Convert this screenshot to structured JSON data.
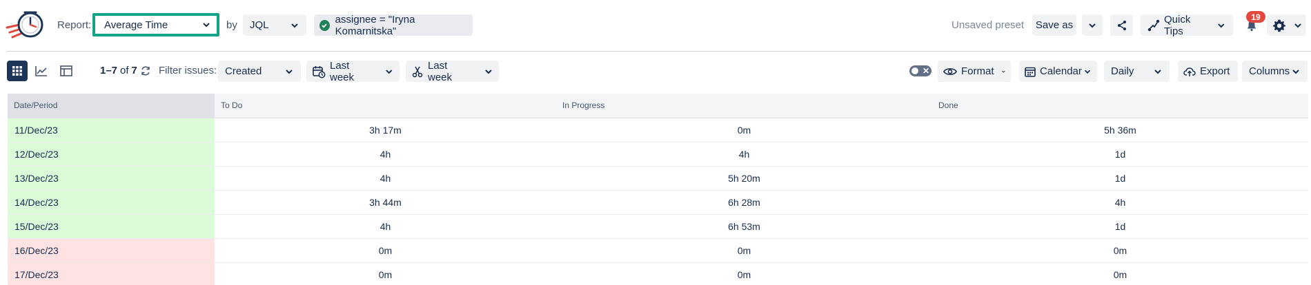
{
  "header": {
    "report_label": "Report:",
    "report_value": "Average Time",
    "by_label": "by",
    "by_value": "JQL",
    "jql_query": "assignee = \"Iryna Komarnitska\"",
    "unsaved_preset": "Unsaved preset",
    "save_as": "Save as",
    "quick_tips": "Quick Tips",
    "notification_count": "19"
  },
  "toolbar": {
    "range_start_end": "1–7",
    "range_of": "of",
    "range_total": "7",
    "filter_label": "Filter issues:",
    "filter_value": "Created",
    "date_filter_1": "Last week",
    "date_filter_2": "Last week",
    "format": "Format",
    "calendar": "Calendar",
    "granularity": "Daily",
    "export": "Export",
    "columns": "Columns"
  },
  "colors": {
    "accent_highlight": "#13a388",
    "weekday_row": "#dcfbd9",
    "weekend_row": "#ffe2e2",
    "badge": "#e2483d"
  },
  "table": {
    "headers": [
      "Date/Period",
      "To Do",
      "In Progress",
      "Done"
    ],
    "rows": [
      {
        "date": "11/Dec/23",
        "todo": "3h 17m",
        "inprogress": "0m",
        "done": "5h 36m",
        "status": "weekday"
      },
      {
        "date": "12/Dec/23",
        "todo": "4h",
        "inprogress": "4h",
        "done": "1d",
        "status": "weekday"
      },
      {
        "date": "13/Dec/23",
        "todo": "4h",
        "inprogress": "5h 20m",
        "done": "1d",
        "status": "weekday"
      },
      {
        "date": "14/Dec/23",
        "todo": "3h 44m",
        "inprogress": "6h 28m",
        "done": "4h",
        "status": "weekday"
      },
      {
        "date": "15/Dec/23",
        "todo": "4h",
        "inprogress": "6h 53m",
        "done": "1d",
        "status": "weekday"
      },
      {
        "date": "16/Dec/23",
        "todo": "0m",
        "inprogress": "0m",
        "done": "0m",
        "status": "weekend"
      },
      {
        "date": "17/Dec/23",
        "todo": "0m",
        "inprogress": "0m",
        "done": "0m",
        "status": "weekend"
      }
    ]
  }
}
